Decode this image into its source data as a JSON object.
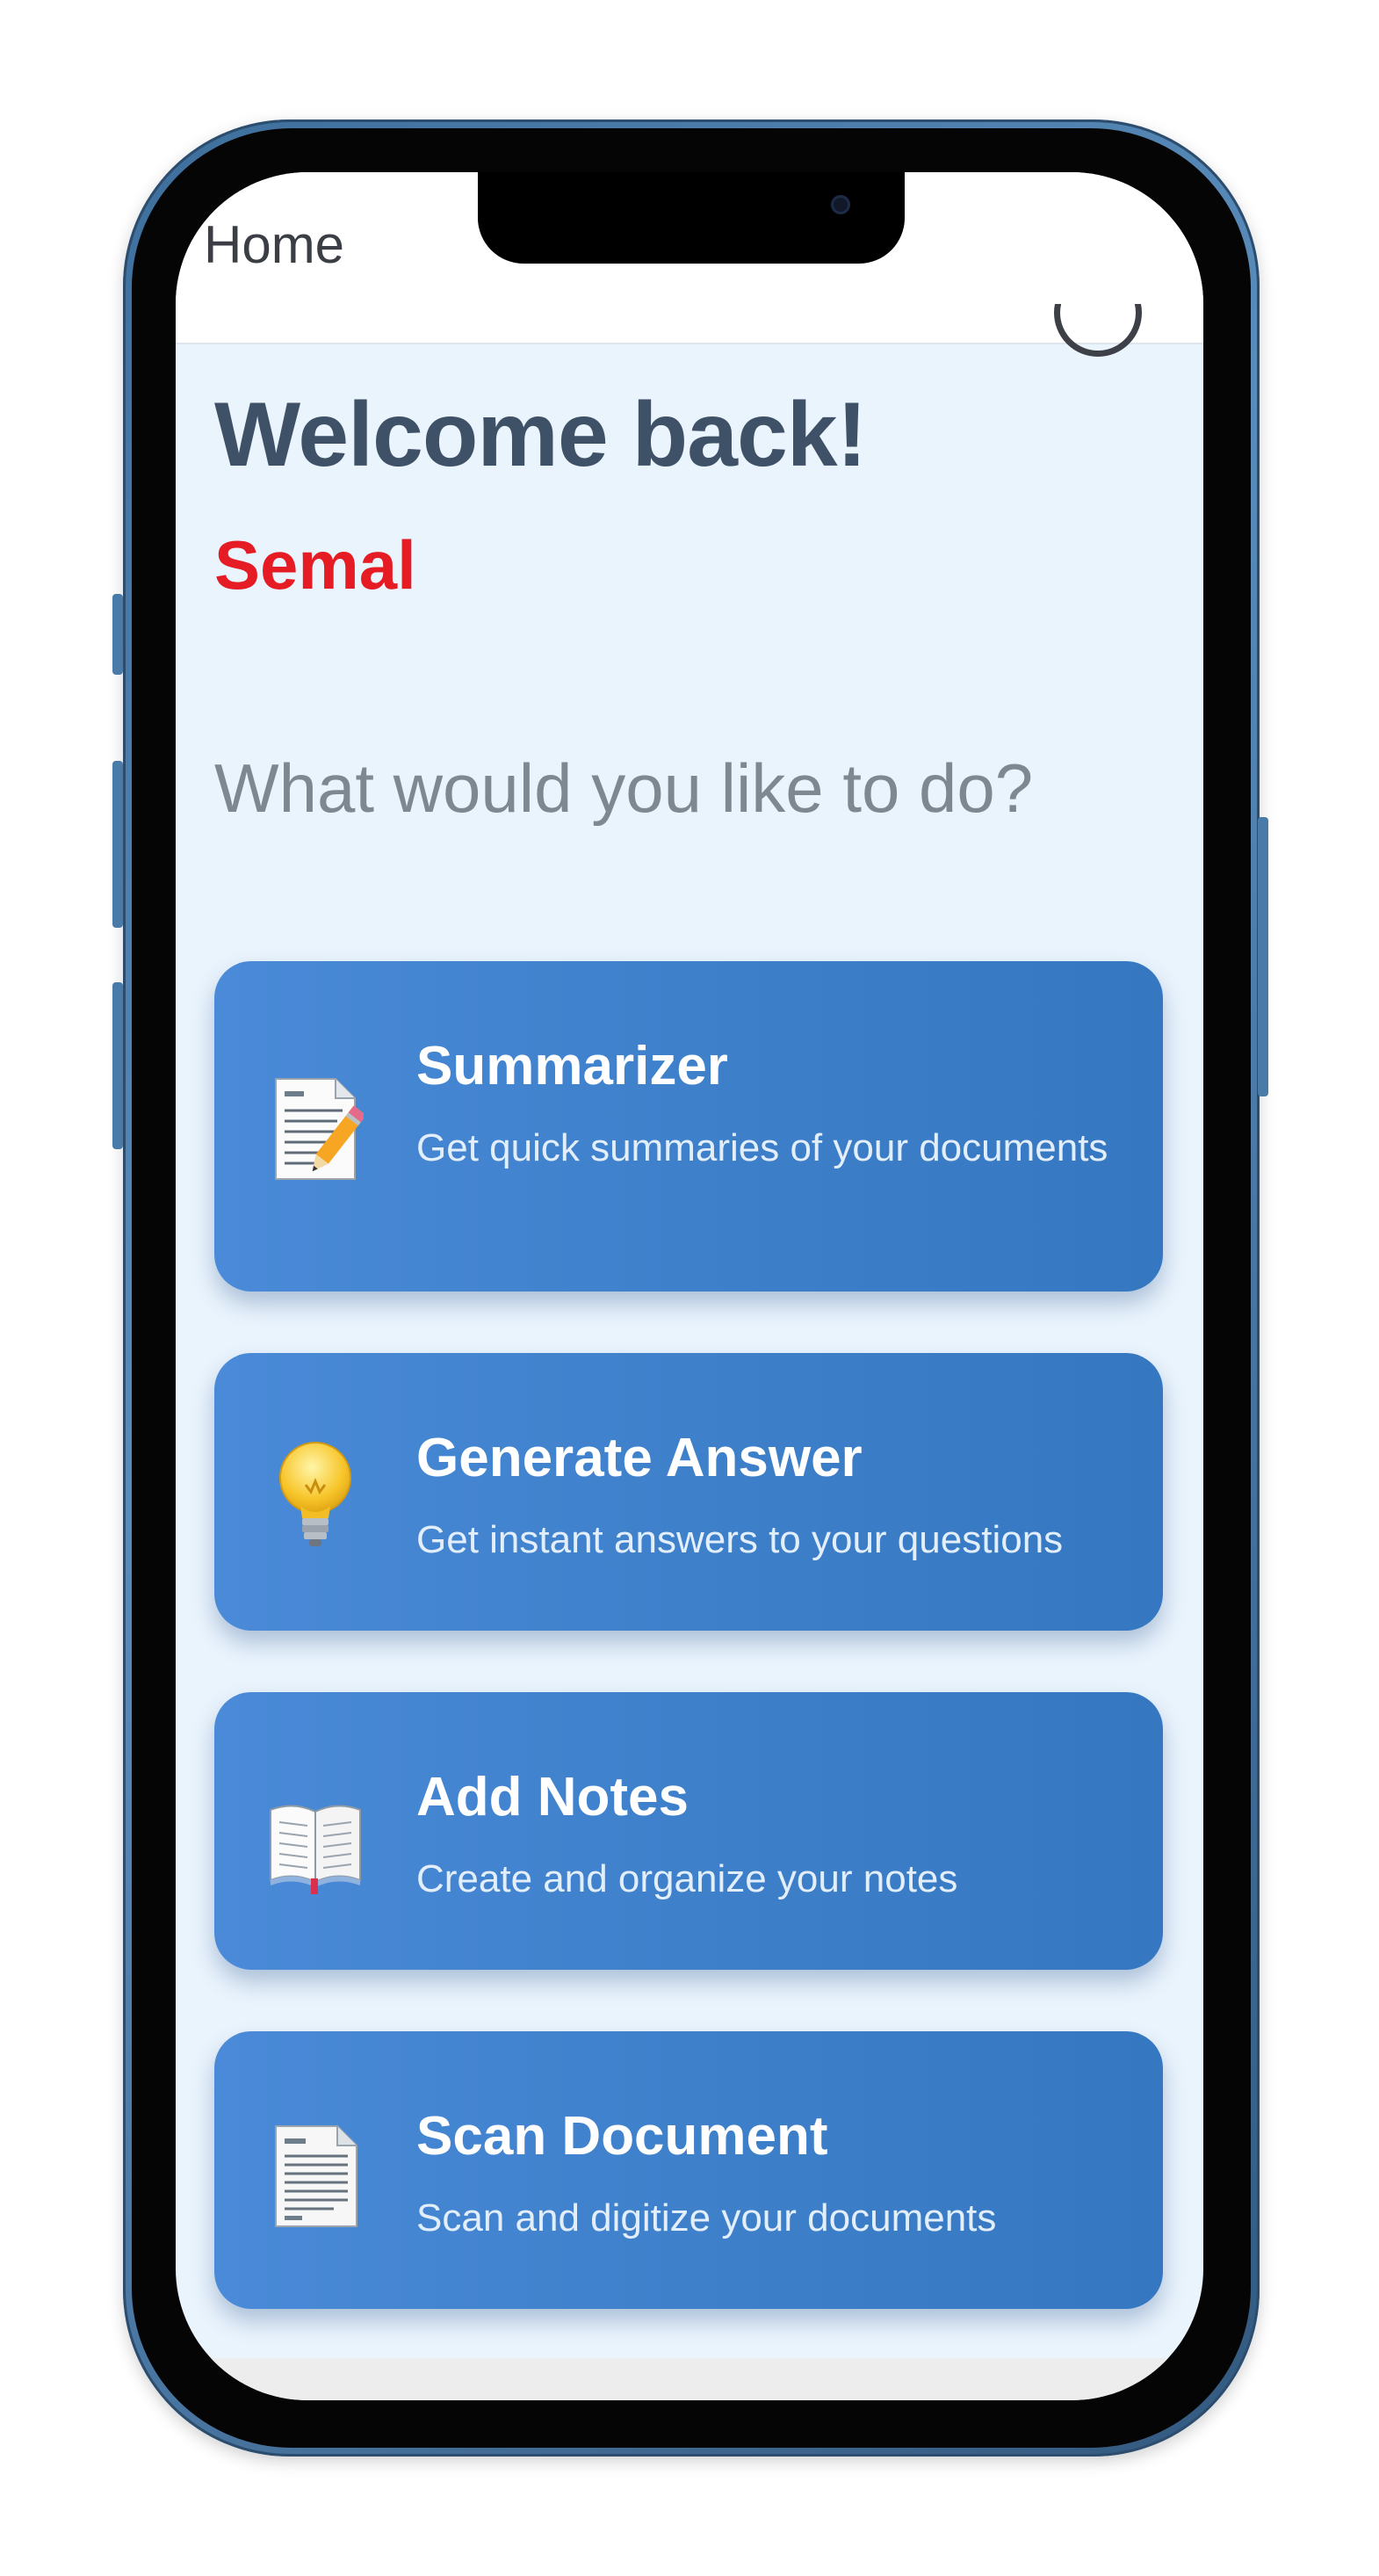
{
  "app_bar": {
    "title": "Home"
  },
  "welcome": {
    "heading": "Welcome back!",
    "username": "Semal",
    "prompt": "What would you like to do?"
  },
  "actions": [
    {
      "title": "Summarizer",
      "description": "Get quick summaries of your documents",
      "icon": "memo-pencil-icon"
    },
    {
      "title": "Generate Answer",
      "description": "Get instant answers to your questions",
      "icon": "lightbulb-icon"
    },
    {
      "title": "Add Notes",
      "description": "Create and organize your notes",
      "icon": "open-book-icon"
    },
    {
      "title": "Scan Document",
      "description": "Scan and digitize your documents",
      "icon": "document-icon"
    }
  ],
  "colors": {
    "background": "#eaf4fd",
    "card_start": "#4a8ad8",
    "card_end": "#3577c0",
    "username": "#e51c23",
    "heading": "#3f5166",
    "prompt": "#7d8890",
    "phone_frame": "#4a7aa8"
  }
}
